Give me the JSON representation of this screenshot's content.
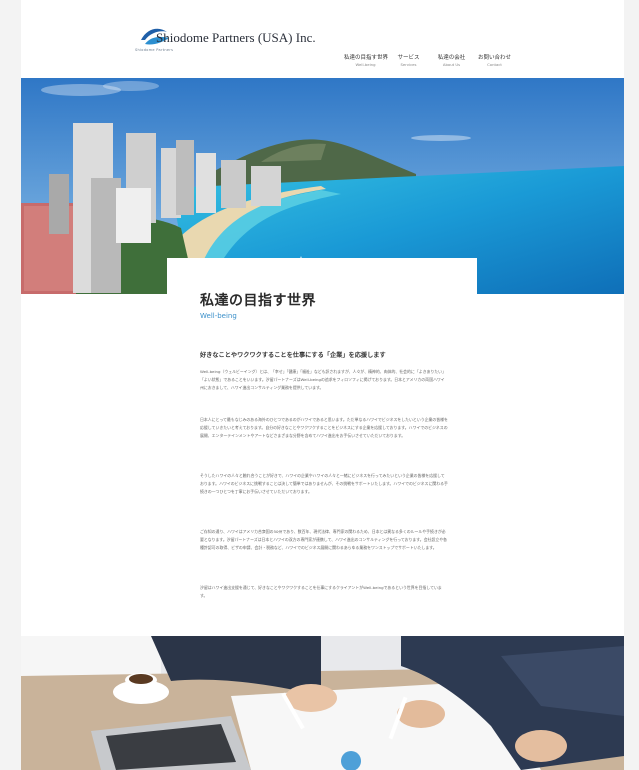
{
  "header": {
    "brand_name": "Shiodome Partners (USA) Inc.",
    "logo_tagline": "Shiodome Partners",
    "nav": [
      {
        "jp": "私達の目指す世界",
        "en": "Well-being"
      },
      {
        "jp": "サービス",
        "en": "Services"
      },
      {
        "jp": "私達の会社",
        "en": "About Us"
      },
      {
        "jp": "お問い合わせ",
        "en": "Contact"
      }
    ]
  },
  "section": {
    "title": "私達の目指す世界",
    "subtitle": "Well-being",
    "lead": "好きなことやワクワクすることを仕事にする「企業」を応援します",
    "paragraphs": [
      "Well-being（ウェルビーイング）とは、「幸せ」「健康」「福祉」なども訳されますが、人々が、精神的、肉体的、社会的に「よきありたい」「よい状態」であることをいいます。汐留パートナーズはWell-beingの追求をフィロソフィに掲げております。日本とアメリカの両国ハワイ州におきまして、ハワイ進出コンサルティング業務を提供しています。",
      "日本人にとって最もなじみのある海外のひとつであるのがハワイであると思います。ただ単なるハワイでビジネスをしたいという企業の皆様を応援していきたいと考えております。自分の好きなことやワクワクすることをビジネスにする企業を応援しております。ハワイでのビジネスの展開、エンターテインメントやアートなどさまざまな分野を含めてハワイ進出をお手伝いさせていただいております。",
      "そうしたハワイの人々と触れ合うことが好きで、ハワイの企業やハワイの人々と一緒にビジネスを行ってみたいという企業の皆様を応援しております。ハワイのビジネスに挑戦することは決して簡単ではありませんが、その挑戦をサポートいたします。ハワイでのビジネスに関わる手続きの一つひとつを丁寧にお手伝いさせていただいております。",
      "ご存知の通り、ハワイはアメリカ合衆国の50州であり、数百年、現代法律、専門家の関わるため、日本とは異なる多くのルールや手続きが必要となります。汐留パートナーズは日本とハワイの双方の専門家が連携して、ハワイ進出のコンサルティングを行っております。会社設立や各種許認可の取得、ビザの申請、会計・税務など、ハワイでのビジネス展開に関わるあらゆる業務をワンストップでサポートいたします。",
      "汐留はハワイ進出支援を通じて、好きなことやワクワクすることを仕事にするクライアントがWell-beingであるという世界を目指しています。"
    ]
  },
  "colors": {
    "accent": "#3a8fc9",
    "sky": "#3f86cf",
    "ocean": "#1d9bd6"
  },
  "images": {
    "hero": "waikiki-beach-diamond-head",
    "bottom": "business-meeting-desk"
  }
}
